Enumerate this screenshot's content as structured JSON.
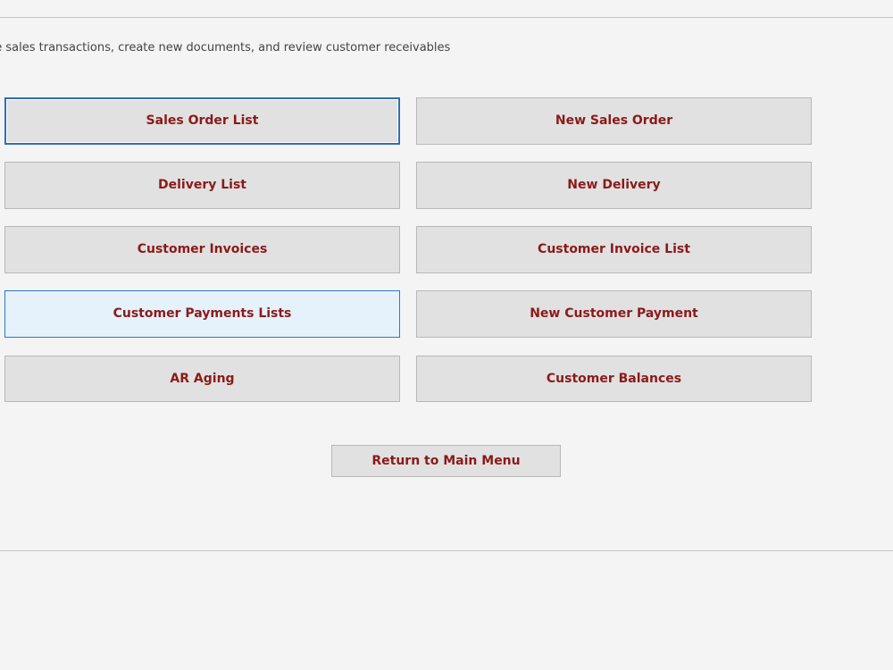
{
  "header": {
    "subtitle": "ge sales transactions, create new documents, and review customer receivables"
  },
  "menu": {
    "sales_order_list": "Sales Order List",
    "new_sales_order": "New Sales Order",
    "delivery_list": "Delivery List",
    "new_delivery": "New Delivery",
    "customer_invoices": "Customer Invoices",
    "customer_invoice_list": "Customer Invoice List",
    "customer_payments_lists": "Customer Payments Lists",
    "new_customer_payment": "New Customer Payment",
    "ar_aging": "AR Aging",
    "customer_balances": "Customer Balances"
  },
  "footer": {
    "return_label": "Return to Main Menu"
  },
  "colors": {
    "button_text": "#8b1a1a",
    "button_face": "#e1e1e1",
    "button_hover": "#e5f1fb",
    "focus_border": "#2f6fb4",
    "background": "#f4f4f4"
  }
}
